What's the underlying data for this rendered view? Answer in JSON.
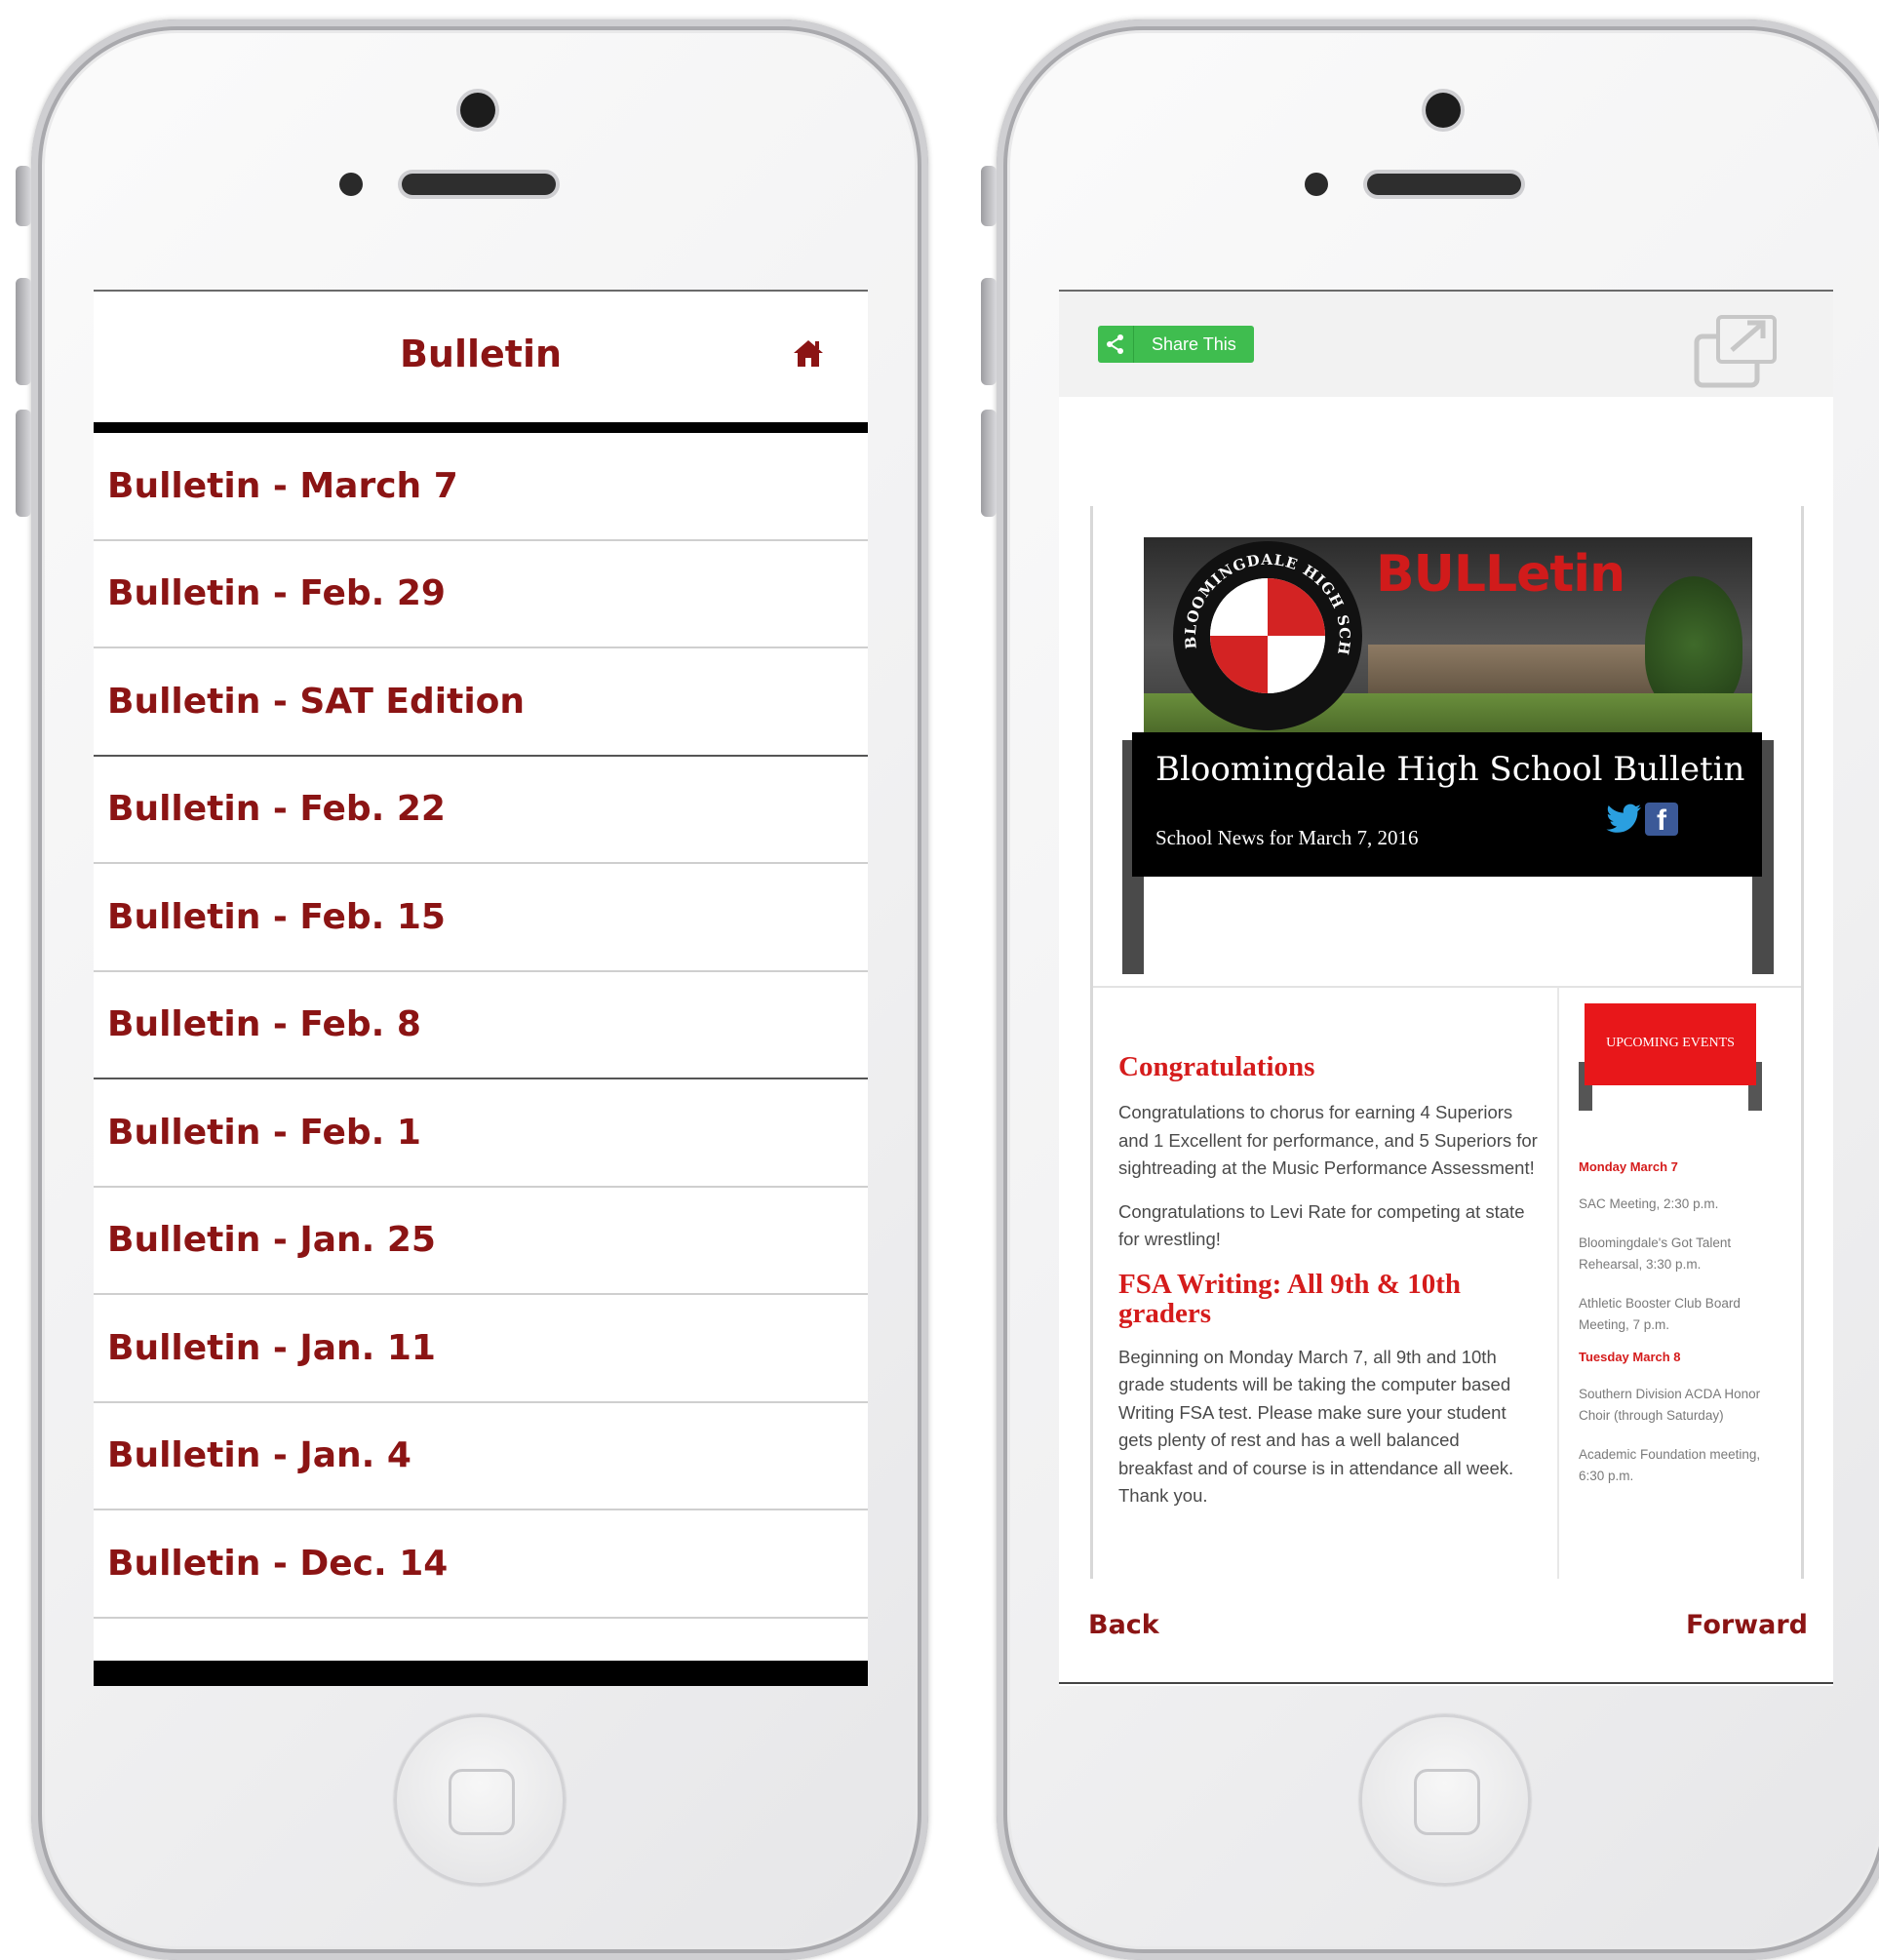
{
  "left_phone": {
    "header": {
      "title": "Bulletin",
      "home_icon": "home-icon"
    },
    "items": [
      {
        "label": "Bulletin - March 7"
      },
      {
        "label": "Bulletin - Feb. 29"
      },
      {
        "label": "Bulletin - SAT Edition"
      },
      {
        "label": "Bulletin - Feb. 22"
      },
      {
        "label": "Bulletin - Feb. 15"
      },
      {
        "label": "Bulletin - Feb. 8"
      },
      {
        "label": "Bulletin - Feb. 1"
      },
      {
        "label": "Bulletin - Jan. 25"
      },
      {
        "label": "Bulletin - Jan. 11"
      },
      {
        "label": "Bulletin - Jan. 4"
      },
      {
        "label": "Bulletin - Dec. 14"
      }
    ]
  },
  "right_phone": {
    "share_label": "Share This",
    "banner": {
      "logo_text": "BULLetin",
      "seal_text": "BLOOMINGDALE HIGH SCHOOL",
      "title": "Bloomingdale High School Bulletin",
      "subtitle": "School News for March 7, 2016"
    },
    "article": {
      "heading1": "Congratulations",
      "p1": "Congratulations to chorus for earning 4 Superiors and 1 Excellent for performance, and 5 Superiors for sightreading at the Music Performance Assessment!",
      "p2": "Congratulations to Levi Rate for competing at state for wrestling!",
      "heading2": "FSA Writing: All 9th & 10th graders",
      "p3": "Beginning on Monday March 7, all 9th and 10th grade students will be taking the computer based Writing FSA test.  Please make sure your student gets plenty of rest and has a well balanced breakfast and of course is in attendance all week. Thank you."
    },
    "sidebar": {
      "upcoming_label": "UPCOMING EVENTS",
      "day1": "Monday March 7",
      "ev1": "SAC Meeting, 2:30 p.m.",
      "ev2": "Bloomingdale's Got Talent Rehearsal, 3:30 p.m.",
      "ev3": "Athletic Booster Club Board Meeting, 7 p.m.",
      "day2": "Tuesday March 8",
      "ev4": "Southern Division ACDA Honor Choir (through Saturday)",
      "ev5": "Academic Foundation meeting, 6:30 p.m."
    },
    "nav": {
      "back": "Back",
      "forward": "Forward"
    }
  },
  "colors": {
    "accent": "#8b1414",
    "red": "#d51c1c",
    "share_green": "#3fbd4f"
  }
}
